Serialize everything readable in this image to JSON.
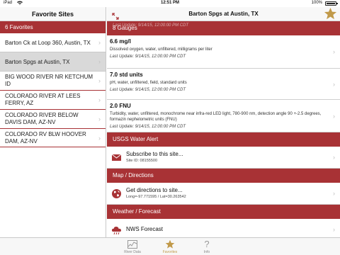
{
  "status_bar": {
    "carrier": "iPad",
    "time": "12:51 PM",
    "battery": "100%",
    "battery_level": 1.0
  },
  "master": {
    "title": "Favorite Sites",
    "section_header": "6 Favorites",
    "items": [
      {
        "label": "Barton Ck at Loop 360, Austin, TX",
        "selected": false
      },
      {
        "label": "Barton Spgs at Austin, TX",
        "selected": true
      },
      {
        "label": "BIG WOOD RIVER NR KETCHUM ID",
        "selected": false
      },
      {
        "label": "COLORADO RIVER AT LEES FERRY, AZ",
        "selected": false
      },
      {
        "label": "COLORADO RIVER BELOW DAVIS DAM, AZ-NV",
        "selected": false
      },
      {
        "label": "COLORADO RV BLW HOOVER DAM, AZ-NV",
        "selected": false
      }
    ]
  },
  "detail": {
    "title": "Barton Spgs at Austin, TX",
    "gauges_header": "8 Gauges",
    "gauges_peek": "Last Update: 9/14/15, 12:00:00 PM CDT",
    "gauges": [
      {
        "value": "6.6 mg/l",
        "description": "Dissolved oxygen, water, unfiltered, milligrams per liter",
        "updated": "Last Update: 9/14/15, 12:00:00 PM CDT"
      },
      {
        "value": "7.0 std units",
        "description": "pH, water, unfiltered, field, standard units",
        "updated": "Last Update: 9/14/15, 12:00:00 PM CDT"
      },
      {
        "value": "2.0 FNU",
        "description": "Turbidity, water, unfiltered, monochrome near infra-red LED light, 780-900 nm, detection angle 90 +-2.5 degrees, formazin nephelometric units (FNU)",
        "updated": "Last Update: 9/14/15, 12:00:00 PM CDT"
      }
    ],
    "alert_header": "USGS Water Alert",
    "alert": {
      "label": "Subscribe to this site...",
      "sub": "Site ID: 08155500",
      "icon": "envelope-icon"
    },
    "map_header": "Map / Directions",
    "map": {
      "label": "Get directions to site...",
      "sub": "Long=-97.771595 / Lat=30.263542",
      "icon": "globe-icon"
    },
    "weather_header": "Weather / Forecast",
    "weather": {
      "label": "NWS Forecast",
      "icon": "cloud-icon"
    }
  },
  "tabs": [
    {
      "label": "River Data",
      "icon": "chart-icon",
      "active": false
    },
    {
      "label": "Favorites",
      "icon": "star-icon",
      "active": true
    },
    {
      "label": "Info",
      "icon": "question-icon",
      "active": false
    }
  ],
  "colors": {
    "accent_red": "#a83235",
    "star_gold": "#c19a4a"
  }
}
